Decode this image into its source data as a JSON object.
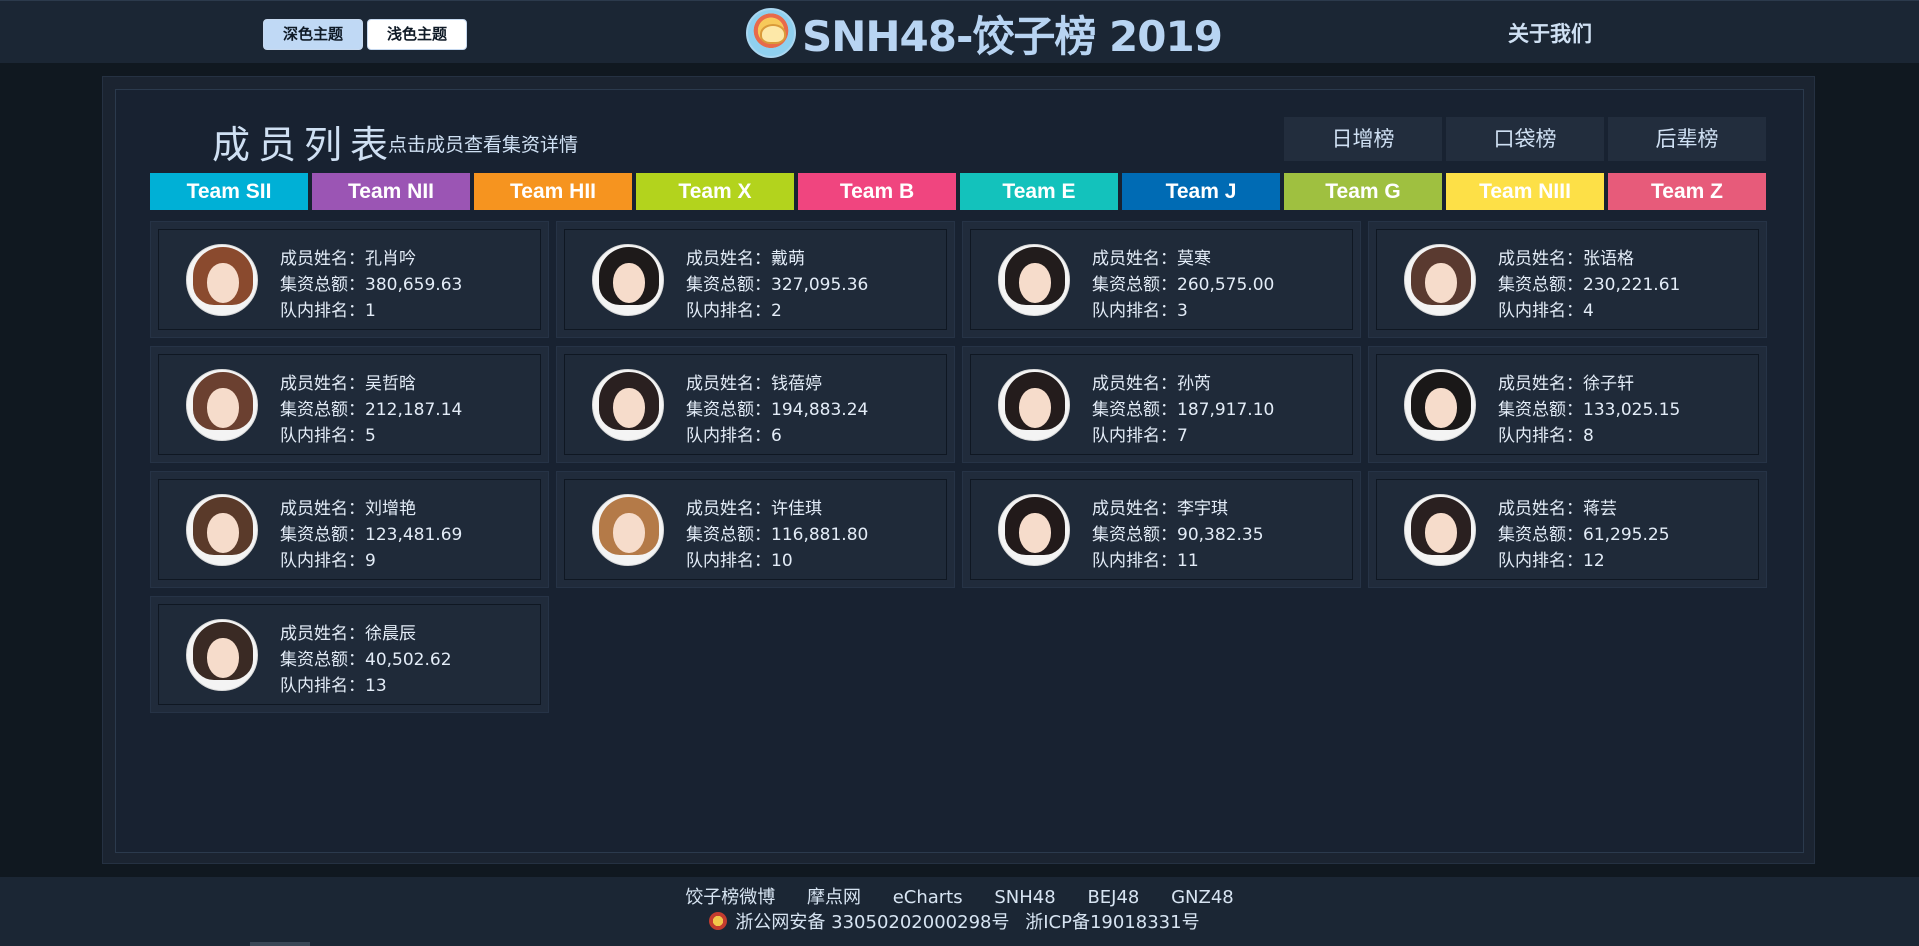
{
  "header": {
    "dark_theme_label": "深色主题",
    "light_theme_label": "浅色主题",
    "title": "SNH48-饺子榜 2019",
    "about_label": "关于我们"
  },
  "section": {
    "title": "成员列表",
    "subtitle": "点击成员查看集资详情"
  },
  "rank_buttons": [
    "日增榜",
    "口袋榜",
    "后辈榜"
  ],
  "teams": [
    {
      "name": "Team SII",
      "color": "#00b0d6"
    },
    {
      "name": "Team NII",
      "color": "#9b55b4"
    },
    {
      "name": "Team HII",
      "color": "#f6941f"
    },
    {
      "name": "Team X",
      "color": "#b3d31d"
    },
    {
      "name": "Team B",
      "color": "#f0457f"
    },
    {
      "name": "Team E",
      "color": "#13c2bc"
    },
    {
      "name": "Team J",
      "color": "#006bb4"
    },
    {
      "name": "Team G",
      "color": "#9fc040"
    },
    {
      "name": "Team NIII",
      "color": "#fde047"
    },
    {
      "name": "Team Z",
      "color": "#e75b7a"
    }
  ],
  "card_labels": {
    "name": "成员姓名：",
    "total": "集资总额：",
    "rank": "队内排名："
  },
  "members": [
    {
      "name": "孔肖吟",
      "total": "380,659.63",
      "rank": "1",
      "hair": "#8a4a2e"
    },
    {
      "name": "戴萌",
      "total": "327,095.36",
      "rank": "2",
      "hair": "#1e1a1a"
    },
    {
      "name": "莫寒",
      "total": "260,575.00",
      "rank": "3",
      "hair": "#221c1c"
    },
    {
      "name": "张语格",
      "total": "230,221.61",
      "rank": "4",
      "hair": "#5a3a30"
    },
    {
      "name": "吴哲晗",
      "total": "212,187.14",
      "rank": "5",
      "hair": "#6b4030"
    },
    {
      "name": "钱蓓婷",
      "total": "194,883.24",
      "rank": "6",
      "hair": "#2a2020"
    },
    {
      "name": "孙芮",
      "total": "187,917.10",
      "rank": "7",
      "hair": "#241c1c"
    },
    {
      "name": "徐子轩",
      "total": "133,025.15",
      "rank": "8",
      "hair": "#1a1818"
    },
    {
      "name": "刘增艳",
      "total": "123,481.69",
      "rank": "9",
      "hair": "#5a3a2a"
    },
    {
      "name": "许佳琪",
      "total": "116,881.80",
      "rank": "10",
      "hair": "#b47a48"
    },
    {
      "name": "李宇琪",
      "total": "90,382.35",
      "rank": "11",
      "hair": "#221a1a"
    },
    {
      "name": "蒋芸",
      "total": "61,295.25",
      "rank": "12",
      "hair": "#2a2020"
    },
    {
      "name": "徐晨辰",
      "total": "40,502.62",
      "rank": "13",
      "hair": "#3a2a24"
    }
  ],
  "footer": {
    "links": [
      "饺子榜微博",
      "摩点网",
      "eCharts",
      "SNH48",
      "BEJ48",
      "GNZ48"
    ],
    "police_record": "浙公网安备 33050202000298号",
    "icp_record": "浙ICP备19018331号"
  }
}
